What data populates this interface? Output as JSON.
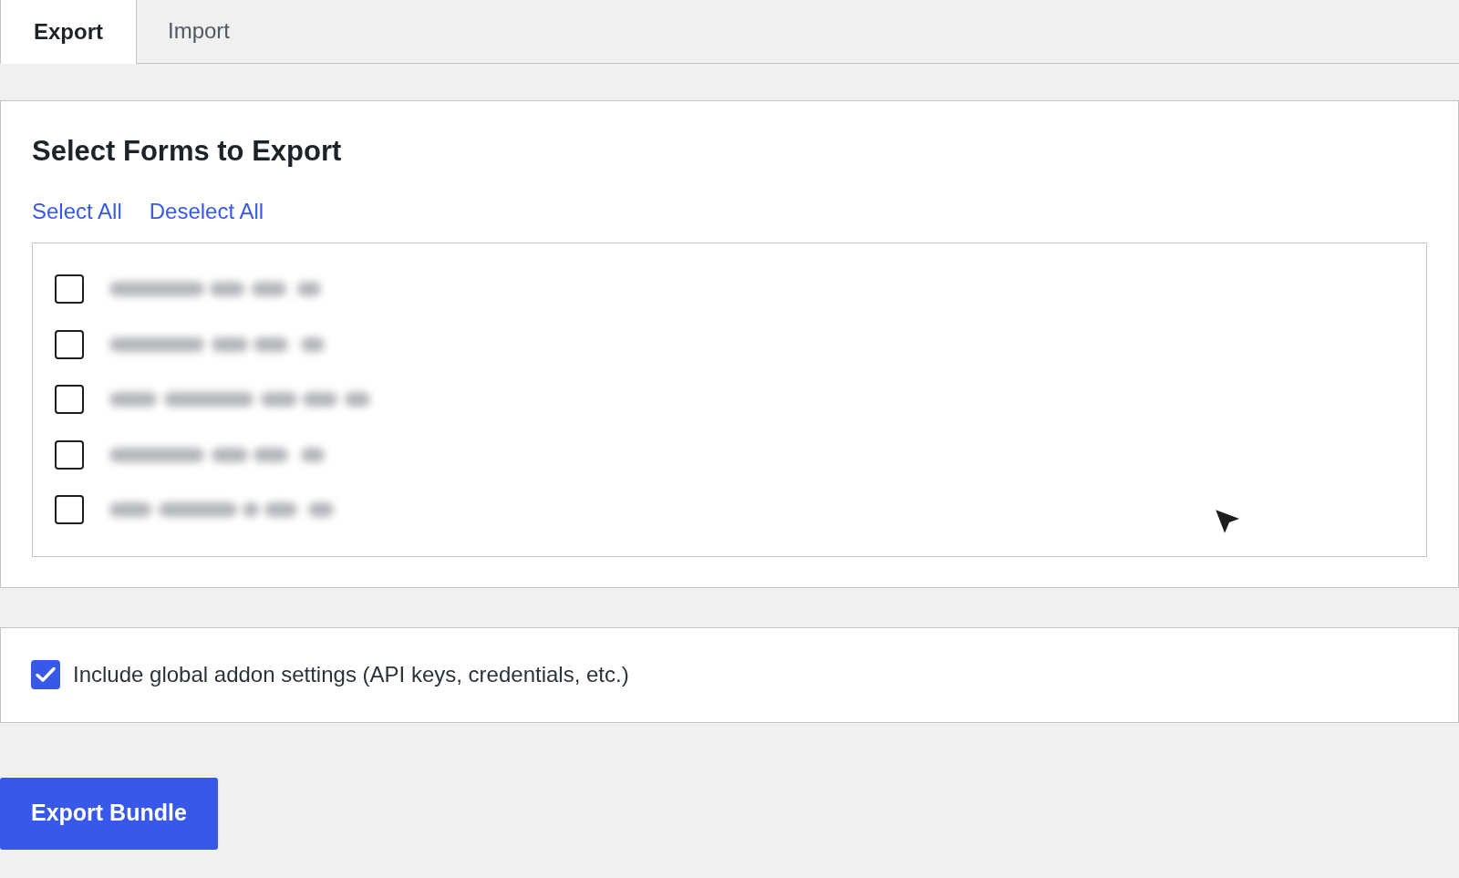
{
  "tabs": [
    {
      "label": "Export",
      "selected": true
    },
    {
      "label": "Import",
      "selected": false
    }
  ],
  "forms_panel": {
    "title": "Select Forms to Export",
    "links": [
      "Select All",
      "Deselect All"
    ],
    "forms": [
      {
        "checked": false
      },
      {
        "checked": false
      },
      {
        "checked": false
      },
      {
        "checked": false
      },
      {
        "checked": false
      }
    ]
  },
  "settings_panel": {
    "option": {
      "label": "Include global addon settings (API keys, credentials, etc.)",
      "checked": true
    }
  },
  "export_button": {
    "label": "Export Bundle"
  }
}
